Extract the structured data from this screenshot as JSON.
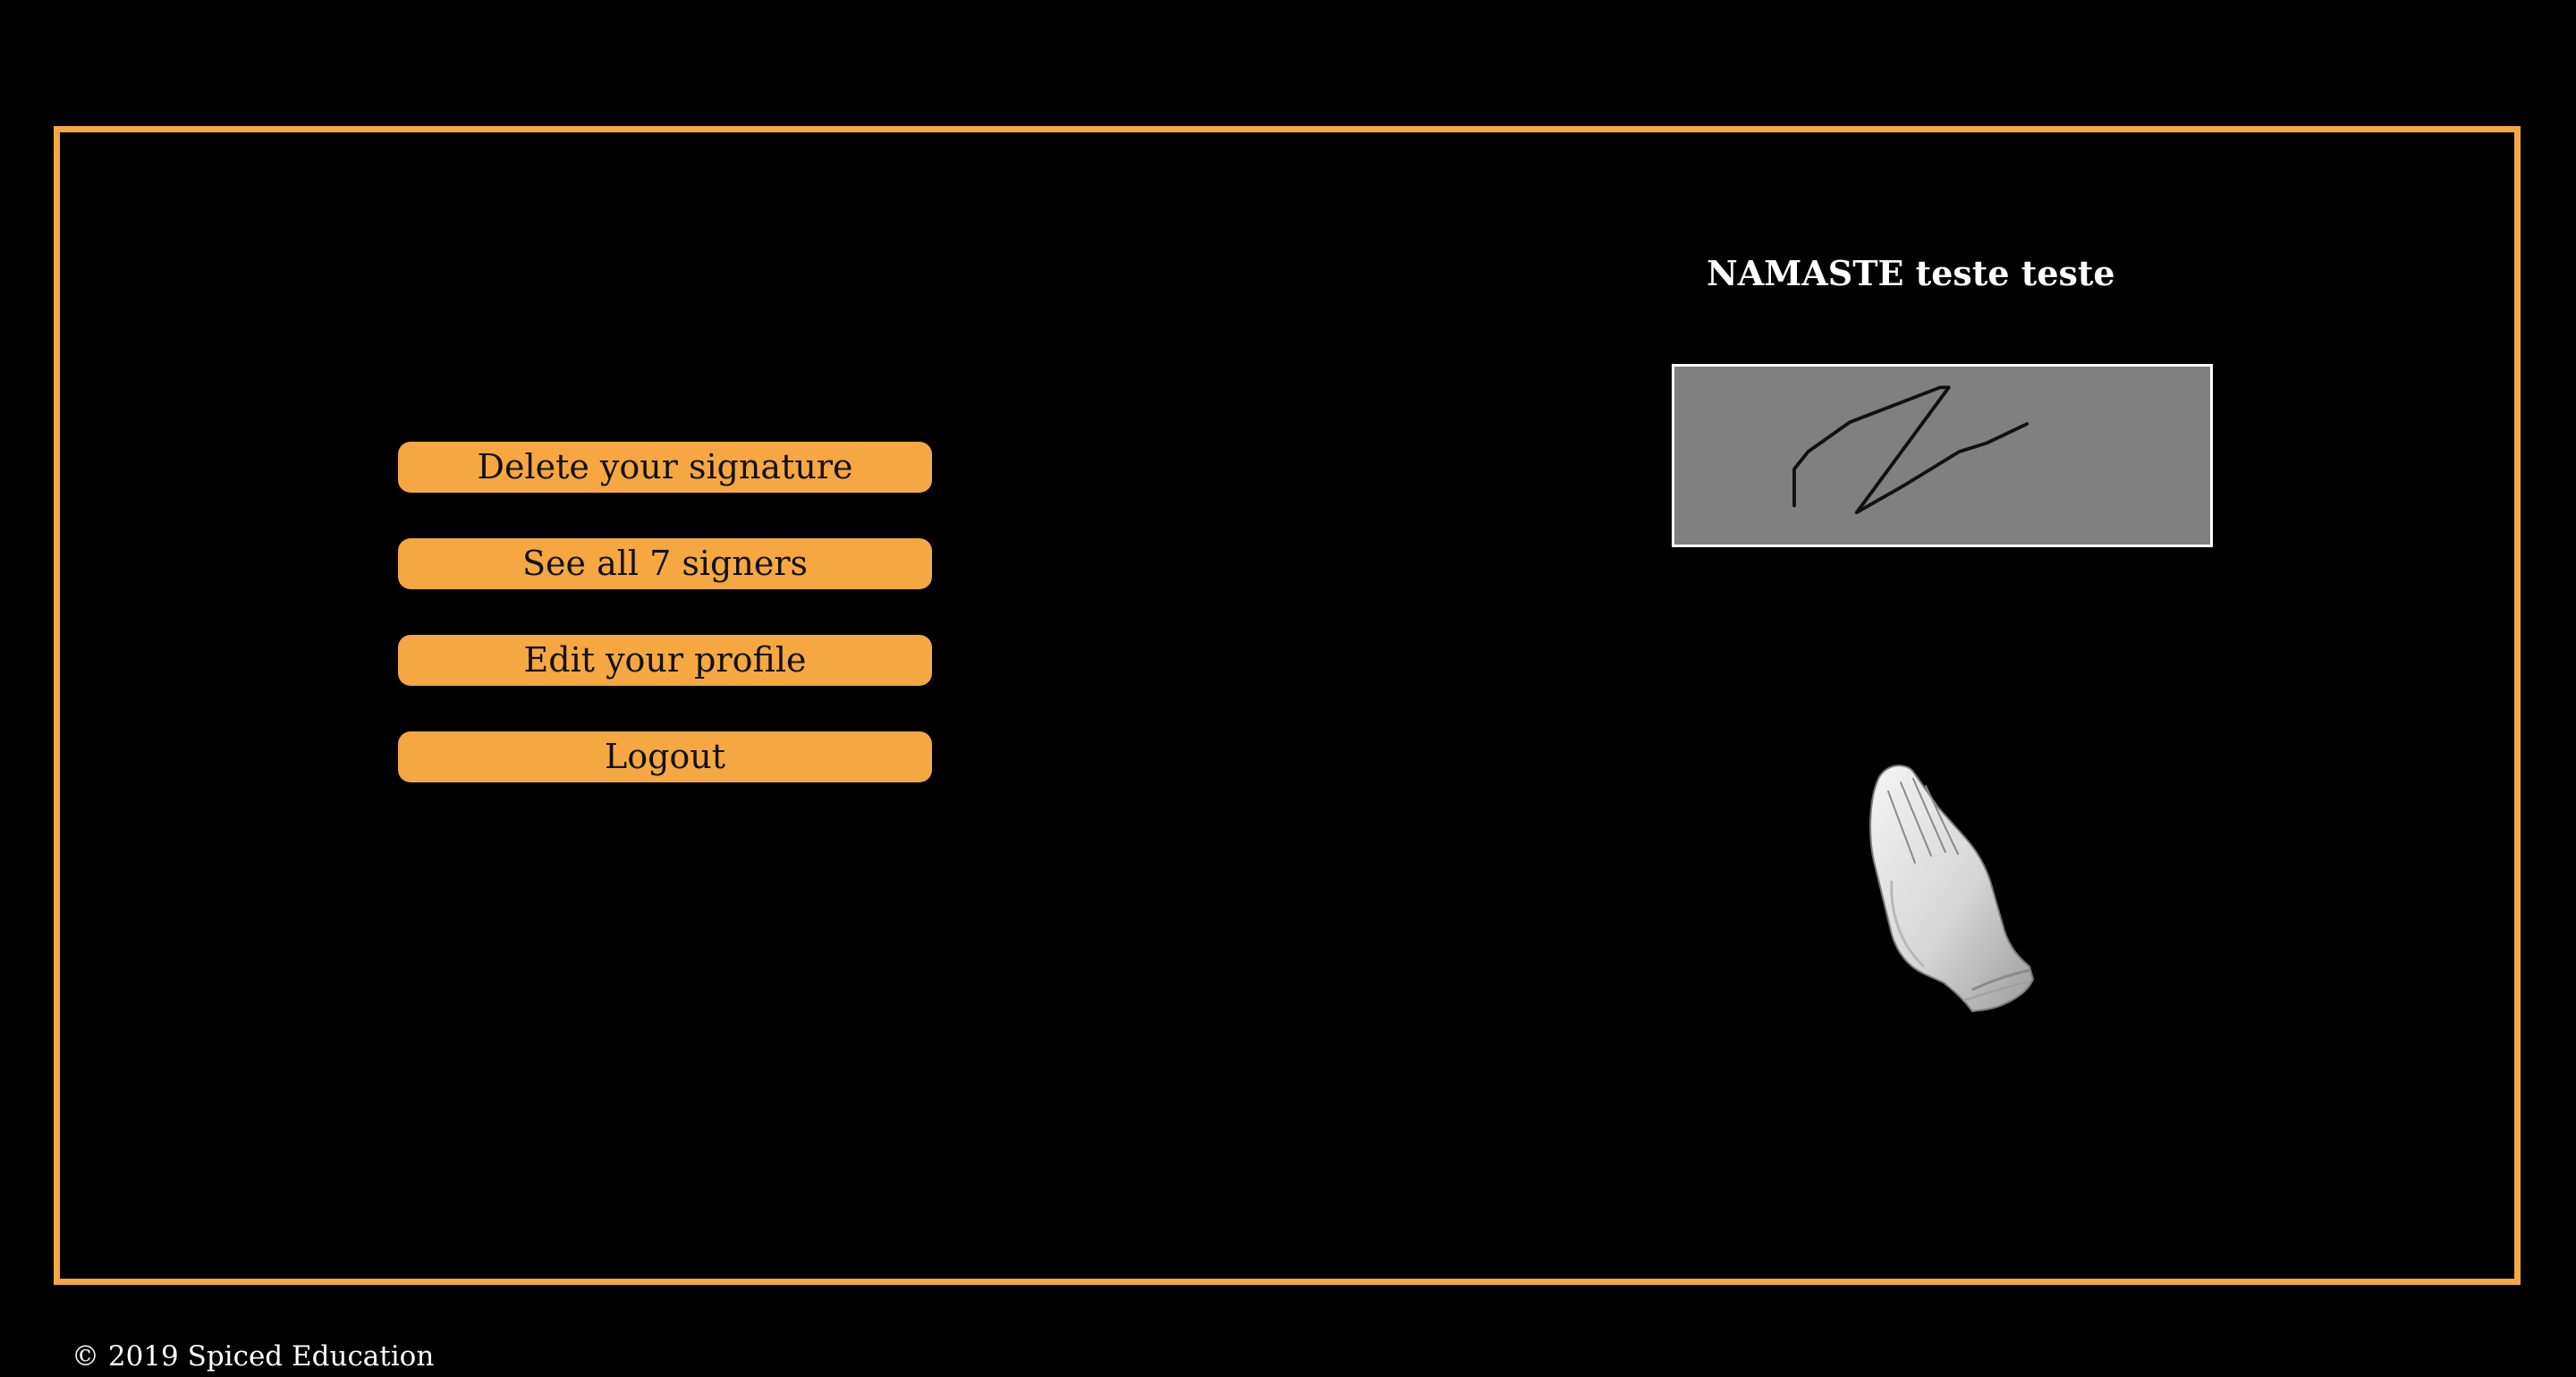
{
  "colors": {
    "background": "#000000",
    "accent": "#f5a742",
    "text": "#ffffff",
    "button_text": "#111111",
    "signature_background": "#808080"
  },
  "menu": {
    "delete_signature": "Delete your signature",
    "see_signers": "See all 7 signers",
    "edit_profile": "Edit your profile",
    "logout": "Logout"
  },
  "greeting": {
    "text": "NAMASTE teste teste"
  },
  "signature": {
    "icon": "handwritten-signature"
  },
  "decoration": {
    "icon": "praying-hands-icon"
  },
  "footer": {
    "copyright": "© 2019 Spiced Education"
  }
}
